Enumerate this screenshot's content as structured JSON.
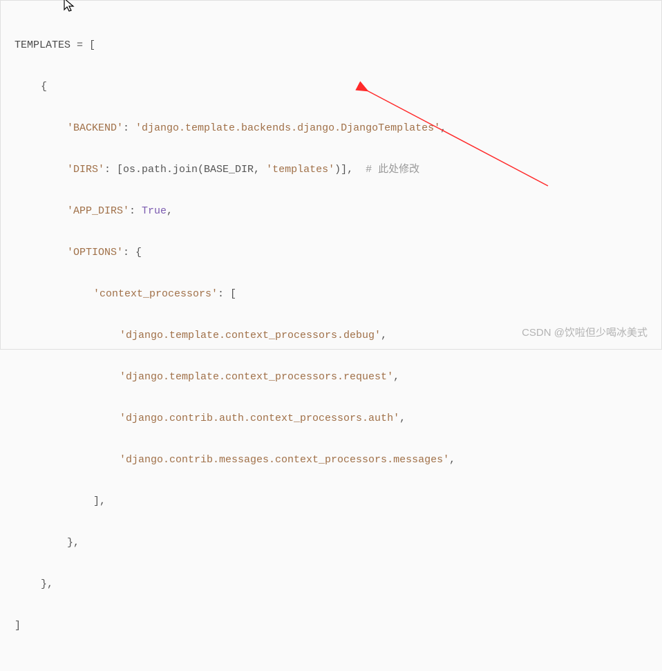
{
  "code": {
    "var_name": "TEMPLATES",
    "equals": " = [",
    "open_brace": "{",
    "backend_key": "'BACKEND'",
    "backend_val": "'django.template.backends.django.DjangoTemplates'",
    "dirs_key": "'DIRS'",
    "dirs_prefix": ": [os.path.join(BASE_DIR, ",
    "dirs_str": "'templates'",
    "dirs_suffix": ")],  ",
    "dirs_comment": "# 此处修改",
    "app_dirs_key": "'APP_DIRS'",
    "true_kw": "True",
    "options_key": "'OPTIONS'",
    "options_open": ": {",
    "ctx_key": "'context_processors'",
    "ctx_open": ": [",
    "cp1": "'django.template.context_processors.debug'",
    "cp2": "'django.template.context_processors.request'",
    "cp3": "'django.contrib.auth.context_processors.auth'",
    "cp4": "'django.contrib.messages.context_processors.messages'",
    "close_bracket": "],",
    "close_brace_comma": "},",
    "close_list": "]",
    "colon_sep": ": ",
    "comma": ","
  },
  "watermark": "CSDN @饮啦但少喝冰美式"
}
